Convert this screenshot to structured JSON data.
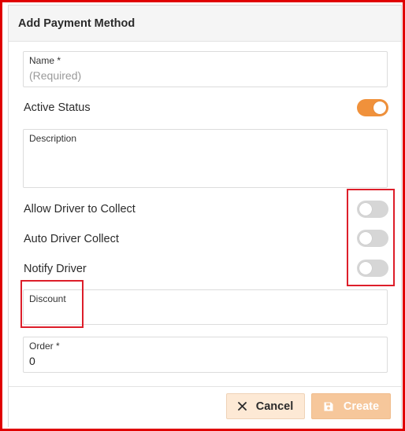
{
  "dialog": {
    "title": "Add Payment Method"
  },
  "fields": {
    "name": {
      "label": "Name *",
      "placeholder": "(Required)"
    },
    "active_status": {
      "label": "Active Status",
      "on": true
    },
    "description": {
      "label": "Description",
      "value": ""
    },
    "allow_driver_collect": {
      "label": "Allow Driver to Collect",
      "on": false
    },
    "auto_driver_collect": {
      "label": "Auto Driver Collect",
      "on": false
    },
    "notify_driver": {
      "label": "Notify Driver",
      "on": false
    },
    "discount": {
      "label": "Discount",
      "value": ""
    },
    "order": {
      "label": "Order *",
      "value": "0"
    }
  },
  "footer": {
    "cancel_label": "Cancel",
    "create_label": "Create"
  },
  "icons": {
    "cancel": "close-icon",
    "create": "save-icon"
  },
  "colors": {
    "accent": "#f0913b",
    "toggle_off": "#d6d6d6",
    "cancel_bg": "#fde9d5",
    "create_bg": "#f6c79b",
    "highlight": "#dd1e2a"
  }
}
